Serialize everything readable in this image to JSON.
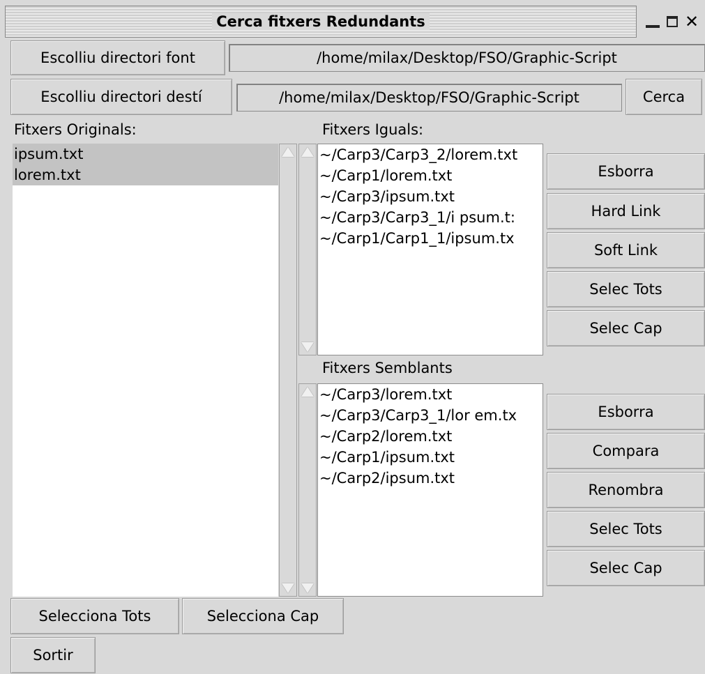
{
  "window": {
    "title": "Cerca fitxers Redundants",
    "controls": [
      "minimize-icon",
      "maximize-icon",
      "close-icon"
    ]
  },
  "source": {
    "button_label": "Escolliu directori font",
    "path": "/home/milax/Desktop/FSO/Graphic-Script"
  },
  "destination": {
    "button_label": "Escolliu directori destí",
    "path": "/home/milax/Desktop/FSO/Graphic-Script",
    "search_label": "Cerca"
  },
  "originals": {
    "label": "Fitxers Originals:",
    "items": [
      "ipsum.txt",
      "lorem.txt"
    ],
    "selected": [
      0,
      1
    ]
  },
  "equal": {
    "label": "Fitxers Iguals:",
    "items": [
      "~/Carp3/Carp3_2/lorem.txt",
      "~/Carp1/lorem.txt",
      "~/Carp3/ipsum.txt",
      "~/Carp3/Carp3_1/i psum.t:",
      "~/Carp1/Carp1_1/ipsum.tx"
    ],
    "actions": [
      "Esborra",
      "Hard Link",
      "Soft Link",
      "Selec Tots",
      "Selec Cap"
    ]
  },
  "similar": {
    "label": "Fitxers Semblants",
    "items": [
      "~/Carp3/lorem.txt",
      "~/Carp3/Carp3_1/lor em.tx",
      "~/Carp2/lorem.txt",
      "~/Carp1/ipsum.txt",
      "~/Carp2/ipsum.txt"
    ],
    "actions": [
      "Esborra",
      "Compara",
      "Renombra",
      "Selec Tots",
      "Selec Cap"
    ]
  },
  "bottom": {
    "select_all": "Selecciona Tots",
    "select_none": "Selecciona Cap",
    "exit": "Sortir"
  }
}
